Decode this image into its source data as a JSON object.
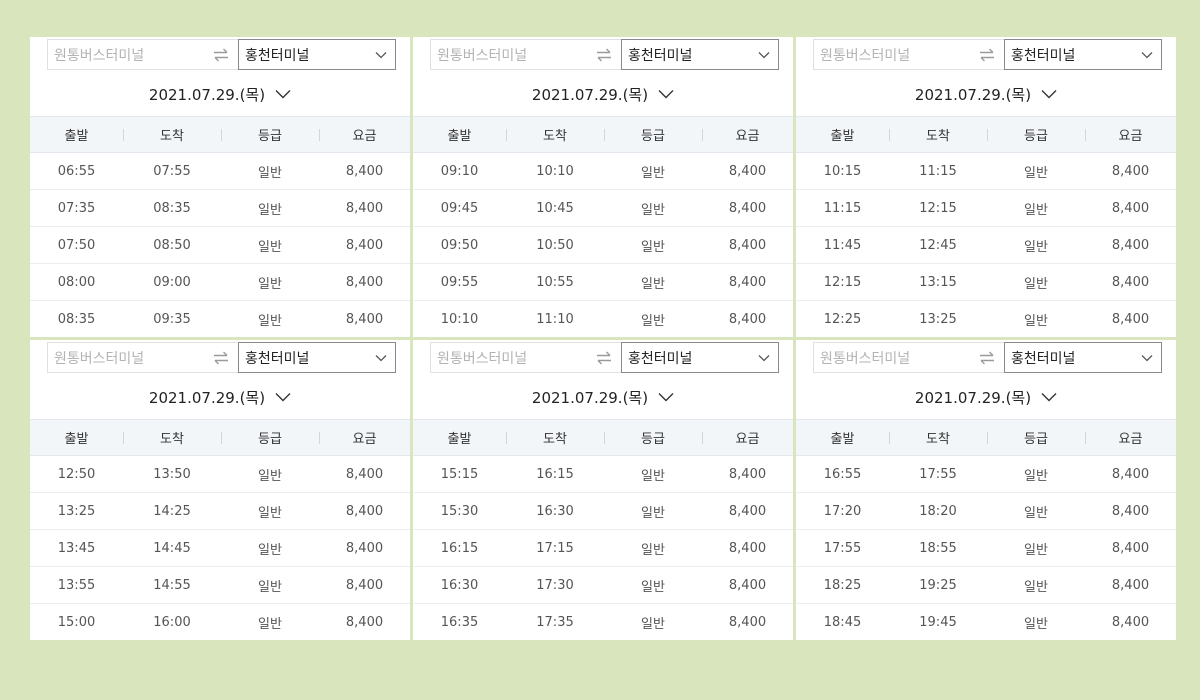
{
  "colors": {
    "background": "#d9e5bd",
    "panel": "#ffffff",
    "header_bg": "#f3f6f9"
  },
  "columns": [
    "출발",
    "도착",
    "등급",
    "요금"
  ],
  "panels": [
    {
      "origin_placeholder": "원통버스터미널",
      "destination": "홍천터미널",
      "date": "2021.07.29.(목)",
      "rows": [
        [
          "06:55",
          "07:55",
          "일반",
          "8,400"
        ],
        [
          "07:35",
          "08:35",
          "일반",
          "8,400"
        ],
        [
          "07:50",
          "08:50",
          "일반",
          "8,400"
        ],
        [
          "08:00",
          "09:00",
          "일반",
          "8,400"
        ],
        [
          "08:35",
          "09:35",
          "일반",
          "8,400"
        ]
      ]
    },
    {
      "origin_placeholder": "원통버스터미널",
      "destination": "홍천터미널",
      "date": "2021.07.29.(목)",
      "rows": [
        [
          "09:10",
          "10:10",
          "일반",
          "8,400"
        ],
        [
          "09:45",
          "10:45",
          "일반",
          "8,400"
        ],
        [
          "09:50",
          "10:50",
          "일반",
          "8,400"
        ],
        [
          "09:55",
          "10:55",
          "일반",
          "8,400"
        ],
        [
          "10:10",
          "11:10",
          "일반",
          "8,400"
        ]
      ]
    },
    {
      "origin_placeholder": "원통버스터미널",
      "destination": "홍천터미널",
      "date": "2021.07.29.(목)",
      "rows": [
        [
          "10:15",
          "11:15",
          "일반",
          "8,400"
        ],
        [
          "11:15",
          "12:15",
          "일반",
          "8,400"
        ],
        [
          "11:45",
          "12:45",
          "일반",
          "8,400"
        ],
        [
          "12:15",
          "13:15",
          "일반",
          "8,400"
        ],
        [
          "12:25",
          "13:25",
          "일반",
          "8,400"
        ]
      ]
    },
    {
      "origin_placeholder": "원통버스터미널",
      "destination": "홍천터미널",
      "date": "2021.07.29.(목)",
      "rows": [
        [
          "12:50",
          "13:50",
          "일반",
          "8,400"
        ],
        [
          "13:25",
          "14:25",
          "일반",
          "8,400"
        ],
        [
          "13:45",
          "14:45",
          "일반",
          "8,400"
        ],
        [
          "13:55",
          "14:55",
          "일반",
          "8,400"
        ],
        [
          "15:00",
          "16:00",
          "일반",
          "8,400"
        ]
      ]
    },
    {
      "origin_placeholder": "원통버스터미널",
      "destination": "홍천터미널",
      "date": "2021.07.29.(목)",
      "rows": [
        [
          "15:15",
          "16:15",
          "일반",
          "8,400"
        ],
        [
          "15:30",
          "16:30",
          "일반",
          "8,400"
        ],
        [
          "16:15",
          "17:15",
          "일반",
          "8,400"
        ],
        [
          "16:30",
          "17:30",
          "일반",
          "8,400"
        ],
        [
          "16:35",
          "17:35",
          "일반",
          "8,400"
        ]
      ]
    },
    {
      "origin_placeholder": "원통버스터미널",
      "destination": "홍천터미널",
      "date": "2021.07.29.(목)",
      "rows": [
        [
          "16:55",
          "17:55",
          "일반",
          "8,400"
        ],
        [
          "17:20",
          "18:20",
          "일반",
          "8,400"
        ],
        [
          "17:55",
          "18:55",
          "일반",
          "8,400"
        ],
        [
          "18:25",
          "19:25",
          "일반",
          "8,400"
        ],
        [
          "18:45",
          "19:45",
          "일반",
          "8,400"
        ]
      ]
    }
  ]
}
